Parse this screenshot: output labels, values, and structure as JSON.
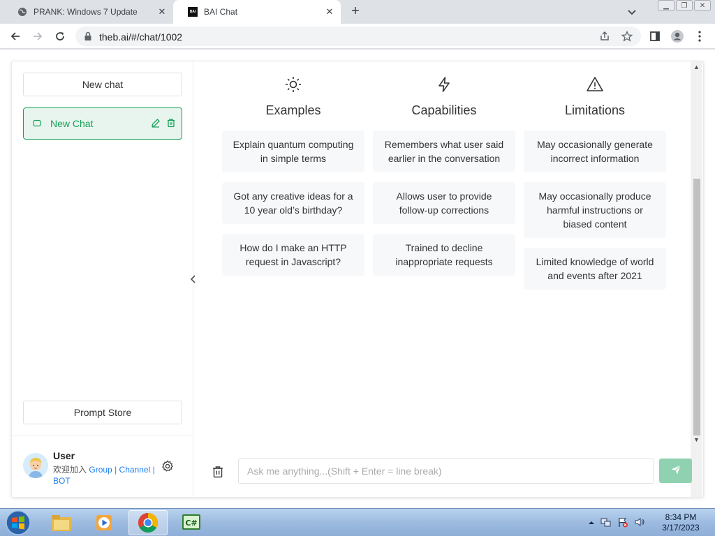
{
  "browser": {
    "tabs": [
      {
        "title": "PRANK: Windows 7 Update",
        "close": "✕"
      },
      {
        "title": "BAI Chat",
        "favicon": "BAI",
        "close": "✕"
      }
    ],
    "new_tab": "+",
    "url": "theb.ai/#/chat/1002"
  },
  "sidebar": {
    "new_chat_label": "New chat",
    "chats": [
      {
        "title": "New Chat"
      }
    ],
    "prompt_store_label": "Prompt Store",
    "user": {
      "name": "User",
      "join_text": "欢迎加入",
      "links": [
        "Group",
        "Channel",
        "BOT"
      ],
      "sep": "|"
    }
  },
  "columns": [
    {
      "icon": "sun-icon",
      "title": "Examples",
      "cards": [
        "Explain quantum computing in simple terms",
        "Got any creative ideas for a 10 year old’s birthday?",
        "How do I make an HTTP request in Javascript?"
      ]
    },
    {
      "icon": "lightning-icon",
      "title": "Capabilities",
      "cards": [
        "Remembers what user said earlier in the conversation",
        "Allows user to provide follow-up corrections",
        "Trained to decline inappropriate requests"
      ]
    },
    {
      "icon": "warning-icon",
      "title": "Limitations",
      "cards": [
        "May occasionally generate incorrect information",
        "May occasionally produce harmful instructions or biased content",
        "Limited knowledge of world and events after 2021"
      ]
    }
  ],
  "composer": {
    "placeholder": "Ask me anything...(Shift + Enter = line break)"
  },
  "taskbar": {
    "time": "8:34 PM",
    "date": "3/17/2023"
  },
  "colors": {
    "accent": "#18a058",
    "send_button": "#8fd1b0"
  }
}
